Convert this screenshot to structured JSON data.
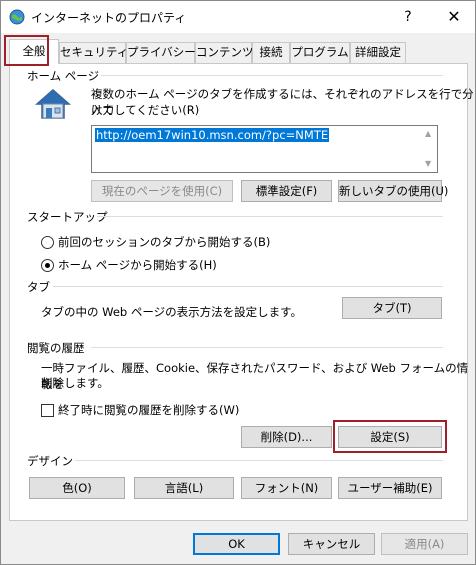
{
  "window": {
    "title": "インターネットのプロパティ",
    "help_glyph": "?",
    "close_glyph": "✕"
  },
  "tabs": [
    {
      "label": "全般"
    },
    {
      "label": "セキュリティ"
    },
    {
      "label": "プライバシー"
    },
    {
      "label": "コンテンツ"
    },
    {
      "label": "接続"
    },
    {
      "label": "プログラム"
    },
    {
      "label": "詳細設定"
    }
  ],
  "homepage": {
    "group": "ホーム ページ",
    "description_line1": "複数のホーム ページのタブを作成するには、それぞれのアドレスを行で分けて",
    "description_line2": "入力してください(R)",
    "url": "http://oem17win10.msn.com/?pc=NMTE",
    "btn_current": "現在のページを使用(C)",
    "btn_default": "標準設定(F)",
    "btn_newtab": "新しいタブの使用(U)"
  },
  "startup": {
    "group": "スタートアップ",
    "option_prev": "前回のセッションのタブから開始する(B)",
    "option_home": "ホーム ページから開始する(H)"
  },
  "tabs_section": {
    "group": "タブ",
    "description": "タブの中の Web ページの表示方法を設定します。",
    "btn": "タブ(T)"
  },
  "history": {
    "group": "閲覧の履歴",
    "description_line1": "一時ファイル、履歴、Cookie、保存されたパスワード、および Web フォームの情報を",
    "description_line2": "削除します。",
    "checkbox": "終了時に閲覧の履歴を削除する(W)",
    "btn_delete": "削除(D)...",
    "btn_settings": "設定(S)"
  },
  "design": {
    "group": "デザイン",
    "btn_colors": "色(O)",
    "btn_languages": "言語(L)",
    "btn_fonts": "フォント(N)",
    "btn_accessibility": "ユーザー補助(E)"
  },
  "footer": {
    "ok": "OK",
    "cancel": "キャンセル",
    "apply": "適用(A)"
  }
}
